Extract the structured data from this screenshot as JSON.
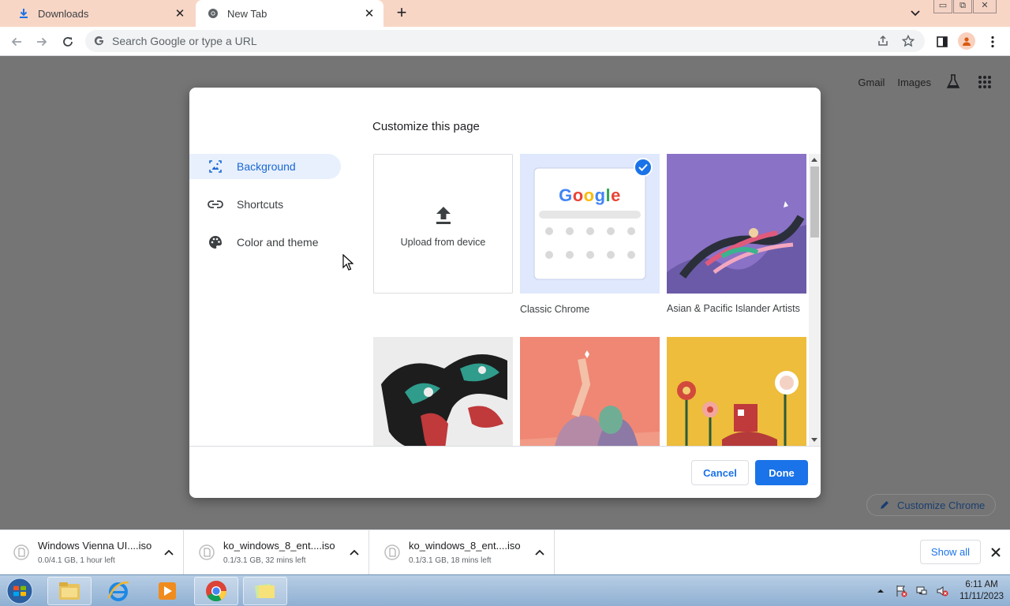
{
  "browser": {
    "tabs": [
      {
        "title": "Downloads"
      },
      {
        "title": "New Tab"
      }
    ],
    "omnibox": {
      "placeholder": "Search Google or type a URL"
    }
  },
  "ntp": {
    "links": {
      "gmail": "Gmail",
      "images": "Images"
    },
    "customize_chrome": "Customize Chrome"
  },
  "dialog": {
    "title": "Customize this page",
    "nav": [
      {
        "label": "Background",
        "icon": "image-icon",
        "active": true
      },
      {
        "label": "Shortcuts",
        "icon": "link-icon",
        "active": false
      },
      {
        "label": "Color and theme",
        "icon": "palette-icon",
        "active": false
      }
    ],
    "tiles": {
      "upload": "Upload from device",
      "classic": "Classic Chrome",
      "classic_logo": "Google",
      "api": "Asian & Pacific Islander Artists"
    },
    "buttons": {
      "cancel": "Cancel",
      "done": "Done"
    }
  },
  "downloads": {
    "items": [
      {
        "name": "Windows Vienna UI....iso",
        "status": "0.0/4.1 GB, 1 hour left"
      },
      {
        "name": "ko_windows_8_ent....iso",
        "status": "0.1/3.1 GB, 32 mins left"
      },
      {
        "name": "ko_windows_8_ent....iso",
        "status": "0.1/3.1 GB, 18 mins left"
      }
    ],
    "show_all": "Show all"
  },
  "taskbar": {
    "time": "6:11 AM",
    "date": "11/11/2023"
  },
  "colors": {
    "accent": "#1a73e8",
    "tabstrip": "#f8d6c6",
    "overlay": "#757575"
  }
}
